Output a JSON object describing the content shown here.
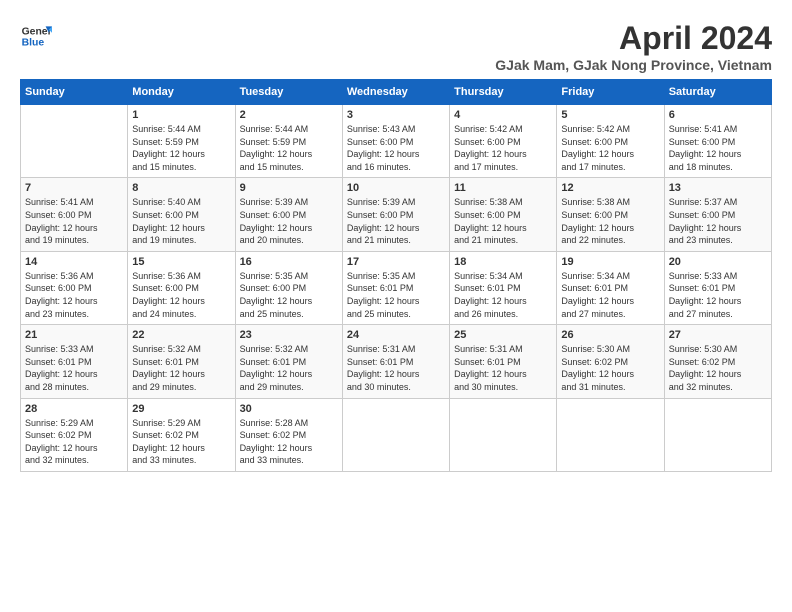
{
  "header": {
    "logo_line1": "General",
    "logo_line2": "Blue",
    "month": "April 2024",
    "location": "GJak Mam, GJak Nong Province, Vietnam"
  },
  "weekdays": [
    "Sunday",
    "Monday",
    "Tuesday",
    "Wednesday",
    "Thursday",
    "Friday",
    "Saturday"
  ],
  "weeks": [
    [
      {
        "day": "",
        "info": ""
      },
      {
        "day": "1",
        "info": "Sunrise: 5:44 AM\nSunset: 5:59 PM\nDaylight: 12 hours\nand 15 minutes."
      },
      {
        "day": "2",
        "info": "Sunrise: 5:44 AM\nSunset: 5:59 PM\nDaylight: 12 hours\nand 15 minutes."
      },
      {
        "day": "3",
        "info": "Sunrise: 5:43 AM\nSunset: 6:00 PM\nDaylight: 12 hours\nand 16 minutes."
      },
      {
        "day": "4",
        "info": "Sunrise: 5:42 AM\nSunset: 6:00 PM\nDaylight: 12 hours\nand 17 minutes."
      },
      {
        "day": "5",
        "info": "Sunrise: 5:42 AM\nSunset: 6:00 PM\nDaylight: 12 hours\nand 17 minutes."
      },
      {
        "day": "6",
        "info": "Sunrise: 5:41 AM\nSunset: 6:00 PM\nDaylight: 12 hours\nand 18 minutes."
      }
    ],
    [
      {
        "day": "7",
        "info": "Sunrise: 5:41 AM\nSunset: 6:00 PM\nDaylight: 12 hours\nand 19 minutes."
      },
      {
        "day": "8",
        "info": "Sunrise: 5:40 AM\nSunset: 6:00 PM\nDaylight: 12 hours\nand 19 minutes."
      },
      {
        "day": "9",
        "info": "Sunrise: 5:39 AM\nSunset: 6:00 PM\nDaylight: 12 hours\nand 20 minutes."
      },
      {
        "day": "10",
        "info": "Sunrise: 5:39 AM\nSunset: 6:00 PM\nDaylight: 12 hours\nand 21 minutes."
      },
      {
        "day": "11",
        "info": "Sunrise: 5:38 AM\nSunset: 6:00 PM\nDaylight: 12 hours\nand 21 minutes."
      },
      {
        "day": "12",
        "info": "Sunrise: 5:38 AM\nSunset: 6:00 PM\nDaylight: 12 hours\nand 22 minutes."
      },
      {
        "day": "13",
        "info": "Sunrise: 5:37 AM\nSunset: 6:00 PM\nDaylight: 12 hours\nand 23 minutes."
      }
    ],
    [
      {
        "day": "14",
        "info": "Sunrise: 5:36 AM\nSunset: 6:00 PM\nDaylight: 12 hours\nand 23 minutes."
      },
      {
        "day": "15",
        "info": "Sunrise: 5:36 AM\nSunset: 6:00 PM\nDaylight: 12 hours\nand 24 minutes."
      },
      {
        "day": "16",
        "info": "Sunrise: 5:35 AM\nSunset: 6:00 PM\nDaylight: 12 hours\nand 25 minutes."
      },
      {
        "day": "17",
        "info": "Sunrise: 5:35 AM\nSunset: 6:01 PM\nDaylight: 12 hours\nand 25 minutes."
      },
      {
        "day": "18",
        "info": "Sunrise: 5:34 AM\nSunset: 6:01 PM\nDaylight: 12 hours\nand 26 minutes."
      },
      {
        "day": "19",
        "info": "Sunrise: 5:34 AM\nSunset: 6:01 PM\nDaylight: 12 hours\nand 27 minutes."
      },
      {
        "day": "20",
        "info": "Sunrise: 5:33 AM\nSunset: 6:01 PM\nDaylight: 12 hours\nand 27 minutes."
      }
    ],
    [
      {
        "day": "21",
        "info": "Sunrise: 5:33 AM\nSunset: 6:01 PM\nDaylight: 12 hours\nand 28 minutes."
      },
      {
        "day": "22",
        "info": "Sunrise: 5:32 AM\nSunset: 6:01 PM\nDaylight: 12 hours\nand 29 minutes."
      },
      {
        "day": "23",
        "info": "Sunrise: 5:32 AM\nSunset: 6:01 PM\nDaylight: 12 hours\nand 29 minutes."
      },
      {
        "day": "24",
        "info": "Sunrise: 5:31 AM\nSunset: 6:01 PM\nDaylight: 12 hours\nand 30 minutes."
      },
      {
        "day": "25",
        "info": "Sunrise: 5:31 AM\nSunset: 6:01 PM\nDaylight: 12 hours\nand 30 minutes."
      },
      {
        "day": "26",
        "info": "Sunrise: 5:30 AM\nSunset: 6:02 PM\nDaylight: 12 hours\nand 31 minutes."
      },
      {
        "day": "27",
        "info": "Sunrise: 5:30 AM\nSunset: 6:02 PM\nDaylight: 12 hours\nand 32 minutes."
      }
    ],
    [
      {
        "day": "28",
        "info": "Sunrise: 5:29 AM\nSunset: 6:02 PM\nDaylight: 12 hours\nand 32 minutes."
      },
      {
        "day": "29",
        "info": "Sunrise: 5:29 AM\nSunset: 6:02 PM\nDaylight: 12 hours\nand 33 minutes."
      },
      {
        "day": "30",
        "info": "Sunrise: 5:28 AM\nSunset: 6:02 PM\nDaylight: 12 hours\nand 33 minutes."
      },
      {
        "day": "",
        "info": ""
      },
      {
        "day": "",
        "info": ""
      },
      {
        "day": "",
        "info": ""
      },
      {
        "day": "",
        "info": ""
      }
    ]
  ]
}
